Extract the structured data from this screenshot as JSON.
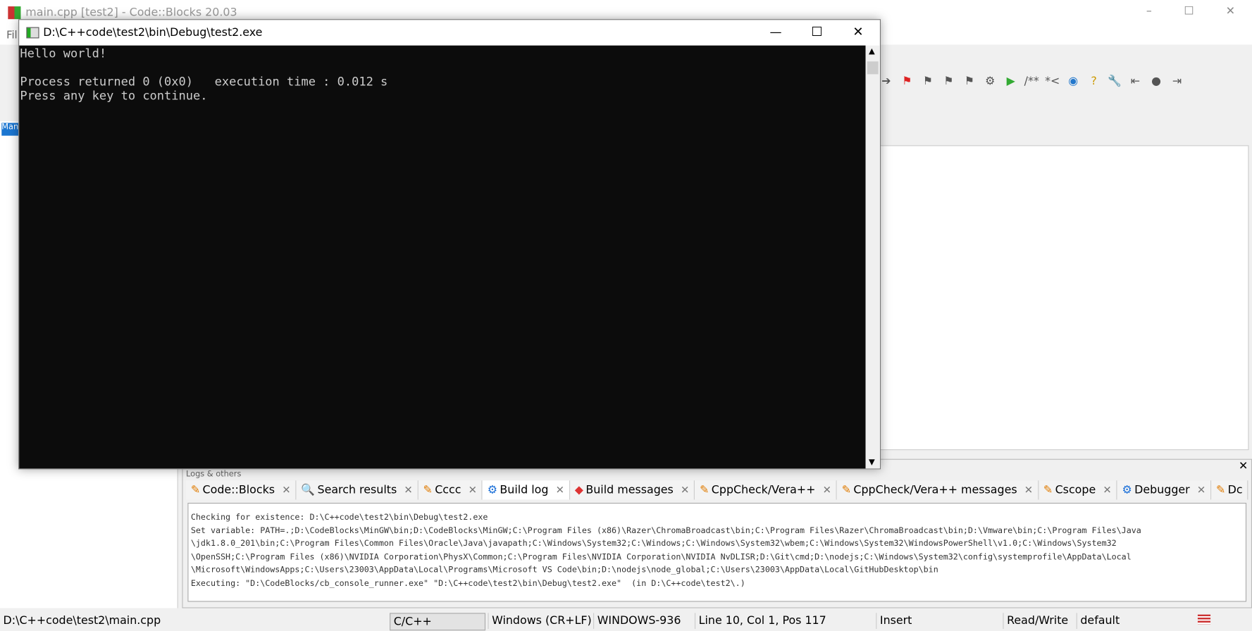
{
  "ide": {
    "title": "main.cpp [test2] - Code::Blocks 20.03",
    "menu_first": "Fil",
    "management_tab": "Man"
  },
  "console": {
    "title": "D:\\C++code\\test2\\bin\\Debug\\test2.exe",
    "lines": [
      "Hello world!",
      "",
      "Process returned 0 (0x0)   execution time : 0.012 s",
      "Press any key to continue."
    ]
  },
  "logs": {
    "title": "Logs & others",
    "tabs": [
      {
        "label": "Code::Blocks",
        "icon": "pencil-icon"
      },
      {
        "label": "Search results",
        "icon": "magnifier-icon"
      },
      {
        "label": "Cccc",
        "icon": "pencil-icon"
      },
      {
        "label": "Build log",
        "icon": "gear-icon",
        "active": true
      },
      {
        "label": "Build messages",
        "icon": "pin-icon"
      },
      {
        "label": "CppCheck/Vera++",
        "icon": "pencil-icon"
      },
      {
        "label": "CppCheck/Vera++ messages",
        "icon": "pencil-icon"
      },
      {
        "label": "Cscope",
        "icon": "pencil-icon"
      },
      {
        "label": "Debugger",
        "icon": "gear-icon"
      },
      {
        "label": "Dc",
        "icon": "pencil-icon"
      }
    ],
    "lines": [
      "Checking for existence: D:\\C++code\\test2\\bin\\Debug\\test2.exe",
      "Set variable: PATH=.;D:\\CodeBlocks\\MinGW\\bin;D:\\CodeBlocks\\MinGW;C:\\Program Files (x86)\\Razer\\ChromaBroadcast\\bin;C:\\Program Files\\Razer\\ChromaBroadcast\\bin;D:\\Vmware\\bin;C:\\Program Files\\Java",
      "\\jdk1.8.0_201\\bin;C:\\Program Files\\Common Files\\Oracle\\Java\\javapath;C:\\Windows\\System32;C:\\Windows;C:\\Windows\\System32\\wbem;C:\\Windows\\System32\\WindowsPowerShell\\v1.0;C:\\Windows\\System32",
      "\\OpenSSH;C:\\Program Files (x86)\\NVIDIA Corporation\\PhysX\\Common;C:\\Program Files\\NVIDIA Corporation\\NVIDIA NvDLISR;D:\\Git\\cmd;D:\\nodejs;C:\\Windows\\System32\\config\\systemprofile\\AppData\\Local",
      "\\Microsoft\\WindowsApps;C:\\Users\\23003\\AppData\\Local\\Programs\\Microsoft VS Code\\bin;D:\\nodejs\\node_global;C:\\Users\\23003\\AppData\\Local\\GitHubDesktop\\bin",
      "Executing: \"D:\\CodeBlocks/cb_console_runner.exe\" \"D:\\C++code\\test2\\bin\\Debug\\test2.exe\"  (in D:\\C++code\\test2\\.)"
    ]
  },
  "status": {
    "file": "D:\\C++code\\test2\\main.cpp",
    "language": "C/C++",
    "eol": "Windows (CR+LF)",
    "encoding": "WINDOWS-936",
    "position": "Line 10, Col 1, Pos 117",
    "mode": "Insert",
    "access": "Read/Write",
    "profile": "default"
  }
}
